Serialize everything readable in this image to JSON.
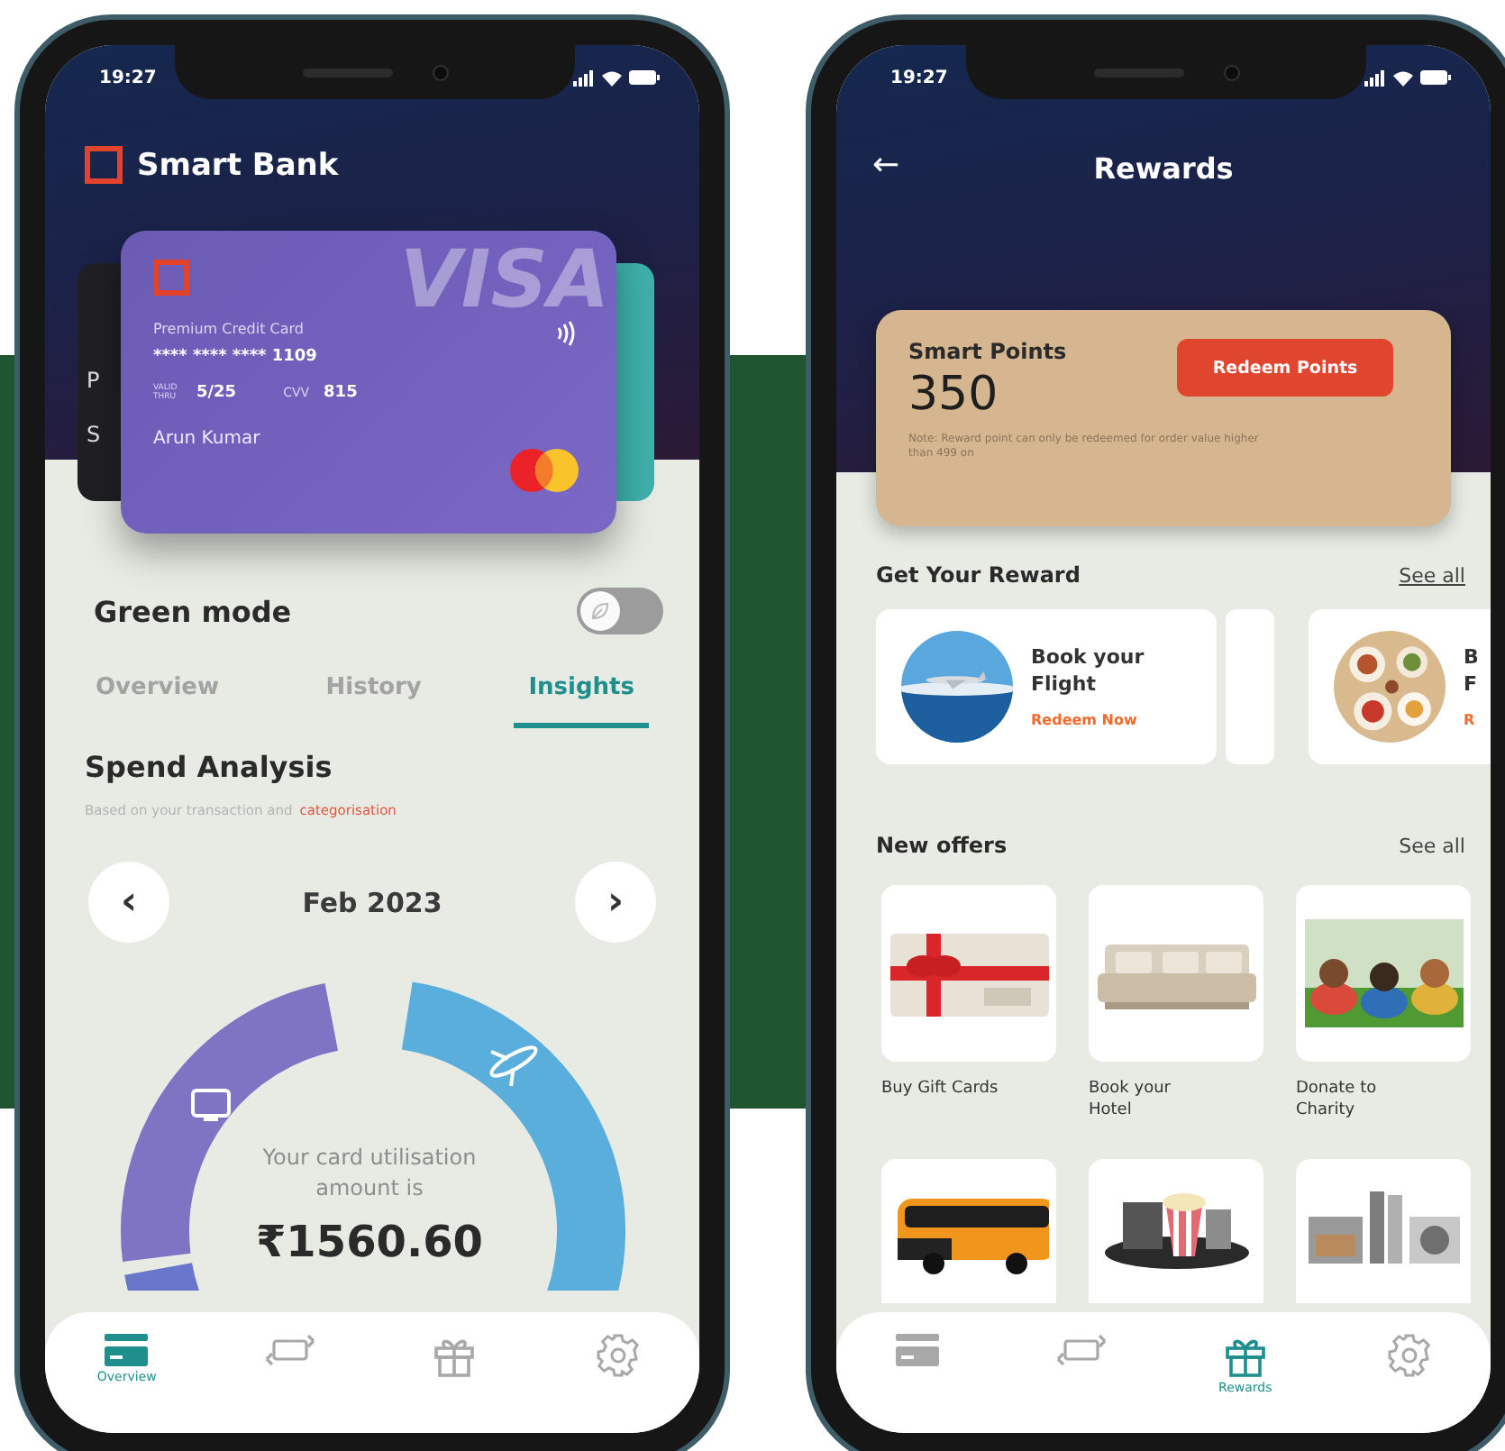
{
  "overview_screen": {
    "status_bar": {
      "time": "19:27"
    },
    "brand": "Smart Bank",
    "cards": {
      "back_card_letters": [
        "P",
        "S"
      ],
      "main_card": {
        "title": "Premium Credit Card",
        "number": "**** **** **** 1109",
        "valid_thru_label": "VALID THRU",
        "expiry": "5/25",
        "cvv_label": "CVV",
        "cvv": "815",
        "holder": "Arun Kumar",
        "network": "VISA"
      }
    },
    "green_mode": {
      "label": "Green mode",
      "on": false
    },
    "tabs": [
      {
        "label": "Overview",
        "selected": false
      },
      {
        "label": "History",
        "selected": false
      },
      {
        "label": "Insights",
        "selected": true
      }
    ],
    "spend_analysis": {
      "title": "Spend Analysis",
      "subtitle": "Based on your transaction and",
      "subtitle_link": "categorisation",
      "prev": "‹",
      "month": "Feb 2023",
      "next": "›",
      "center_text": "Your card utilisation amount is",
      "amount": "₹1560.60"
    },
    "nav": [
      {
        "label": "Overview",
        "selected": true
      },
      {
        "selected": false
      },
      {
        "selected": false
      },
      {
        "selected": false
      }
    ]
  },
  "rewards_screen": {
    "status_bar": {
      "time": "19:27"
    },
    "back": "←",
    "title": "Rewards",
    "points": {
      "label": "Smart Points",
      "value": "350",
      "button": "Redeem Points",
      "note": "Note: Reward point can only be redeemed for order value higher than 499 on"
    },
    "get_reward": {
      "title": "Get Your Reward",
      "see_all": "See all",
      "cards": [
        {
          "title_lines": [
            "Book your",
            "Flight"
          ],
          "action": "Redeem Now"
        },
        {
          "title_lines": [
            "B",
            "F"
          ],
          "action": "R"
        }
      ]
    },
    "new_offers": {
      "title": "New offers",
      "see_all": "See all",
      "items": [
        {
          "label": "Buy Gift Cards"
        },
        {
          "label": "Book your Hotel"
        },
        {
          "label": "Donate to Charity"
        }
      ]
    },
    "nav": [
      {
        "selected": false
      },
      {
        "selected": false
      },
      {
        "label": "Rewards",
        "selected": true
      },
      {
        "selected": false
      }
    ]
  }
}
